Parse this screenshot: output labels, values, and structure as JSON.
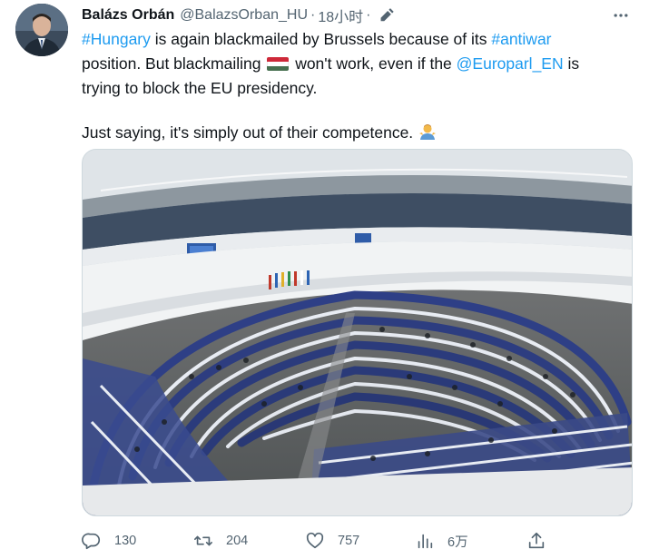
{
  "tweet": {
    "author_name": "Balázs Orbán",
    "author_handle": "@BalazsOrban_HU",
    "separator": "·",
    "time": "18小时",
    "text": {
      "l1_hashtag1": "#Hungary",
      "l1_mid": " is again blackmailed by Brussels because of its ",
      "l1_hashtag2": "#antiwar",
      "l2_a": "position. But blackmailing ",
      "l2_b": " won't work, even if the ",
      "l2_mention": "@Europarl_EN",
      "l2_c": " is",
      "l3": "trying to block the EU presidency.",
      "l4": "Just saying, it's simply out of their competence."
    },
    "icons": {
      "edit": "edit-pencil-icon",
      "more": "more-options-icon",
      "flag": "hungary-flag-emoji",
      "shrug": "person-shrugging-emoji"
    },
    "flag_colors": [
      "#ce2939",
      "#ffffff",
      "#477050"
    ]
  },
  "actions": {
    "reply_count": "130",
    "retweet_count": "204",
    "like_count": "757",
    "views_count": "6万"
  },
  "colors": {
    "link": "#1d9bf0",
    "secondary_text": "#536471",
    "primary_text": "#0f1419"
  }
}
